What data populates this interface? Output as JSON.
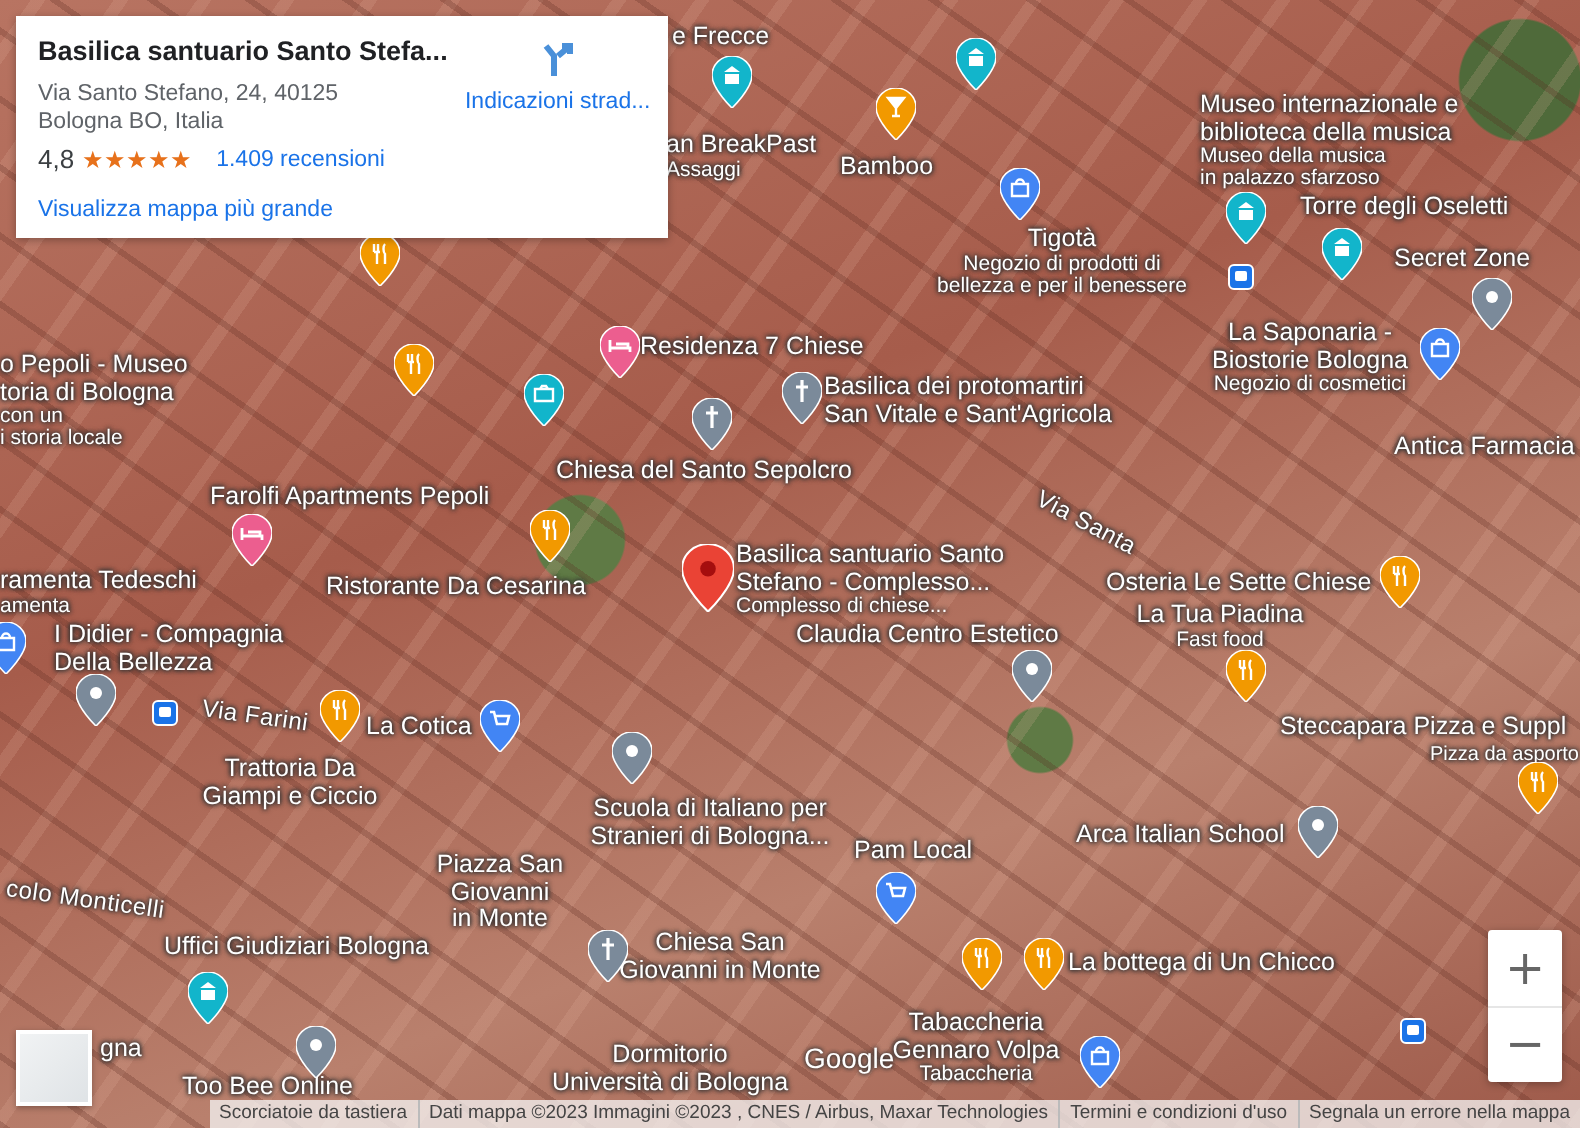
{
  "place_card": {
    "title": "Basilica santuario Santo Stefa...",
    "address_lines": [
      "Via Santo Stefano, 24, 40125",
      "Bologna BO, Italia"
    ],
    "rating": "4,8",
    "stars": 5,
    "reviews": "1.409 recensioni",
    "directions": "Indicazioni strad...",
    "larger_map": "Visualizza mappa più grande"
  },
  "map_labels": [
    {
      "kind": "place",
      "name": [
        "e Frecce"
      ]
    },
    {
      "kind": "place",
      "name": [
        "an BreakPast"
      ],
      "note": [
        "Assaggi"
      ]
    },
    {
      "kind": "place",
      "name": [
        "Bamboo"
      ]
    },
    {
      "kind": "place",
      "name": [
        "Museo internazionale e",
        "biblioteca della musica"
      ],
      "note": [
        "Museo della musica",
        "in palazzo sfarzoso"
      ]
    },
    {
      "kind": "place",
      "name": [
        "Tigotà"
      ],
      "note": [
        "Negozio di prodotti di",
        "bellezza e per il benessere"
      ]
    },
    {
      "kind": "place",
      "name": [
        "Torre degli Oseletti"
      ]
    },
    {
      "kind": "place",
      "name": [
        "Secret Zone"
      ]
    },
    {
      "kind": "place",
      "name": [
        "o Pepoli - Museo",
        "toria di Bologna"
      ],
      "note": [
        "con un",
        "i storia locale"
      ]
    },
    {
      "kind": "place",
      "name": [
        "Residenza 7 Chiese"
      ]
    },
    {
      "kind": "place",
      "name": [
        "Basilica dei protomartiri",
        "San Vitale e Sant'Agricola"
      ]
    },
    {
      "kind": "place",
      "name": [
        "La Saponaria -",
        "Biostorie Bologna"
      ],
      "note": [
        "Negozio di cosmetici"
      ]
    },
    {
      "kind": "place",
      "name": [
        "Farolfi Apartments Pepoli"
      ]
    },
    {
      "kind": "place",
      "name": [
        "Chiesa del Santo Sepolcro"
      ]
    },
    {
      "kind": "place",
      "name": [
        "Antica Farmacia"
      ]
    },
    {
      "kind": "street",
      "name": [
        "Via Santa"
      ]
    },
    {
      "kind": "place",
      "name": [
        "ramenta Tedeschi"
      ],
      "note": [
        "amenta"
      ]
    },
    {
      "kind": "place",
      "name": [
        "Ristorante Da Cesarina"
      ]
    },
    {
      "kind": "place",
      "name": [
        "Basilica santuario Santo",
        "Stefano - Complesso..."
      ],
      "note": [
        "Complesso di chiese..."
      ]
    },
    {
      "kind": "place",
      "name": [
        "Osteria Le Sette Chiese"
      ]
    },
    {
      "kind": "place",
      "name": [
        "I Didier - Compagnia",
        "Della Bellezza"
      ]
    },
    {
      "kind": "place",
      "name": [
        "Claudia Centro Estetico"
      ]
    },
    {
      "kind": "place",
      "name": [
        "La Tua Piadina"
      ],
      "note": [
        "Fast food"
      ]
    },
    {
      "kind": "street",
      "name": [
        "Via Farini"
      ]
    },
    {
      "kind": "place",
      "name": [
        "La Cotica"
      ]
    },
    {
      "kind": "place",
      "name": [
        "Steccapara Pizza e Suppl"
      ]
    },
    {
      "kind": "place",
      "name": [
        "Trattoria Da",
        "Giampi e Ciccio"
      ]
    },
    {
      "kind": "place",
      "name": [
        "Pizza da asporto"
      ],
      "small": true
    },
    {
      "kind": "place",
      "name": [
        "Scuola di Italiano per",
        "Stranieri di Bologna..."
      ]
    },
    {
      "kind": "street",
      "name": [
        "colo Monticelli"
      ]
    },
    {
      "kind": "place",
      "name": [
        "Piazza San",
        "Giovanni",
        "in Monte"
      ]
    },
    {
      "kind": "place",
      "name": [
        "Pam Local"
      ]
    },
    {
      "kind": "place",
      "name": [
        "Arca Italian School"
      ]
    },
    {
      "kind": "place",
      "name": [
        "Uffici Giudiziari Bologna"
      ]
    },
    {
      "kind": "place",
      "name": [
        "Chiesa San",
        "Giovanni in Monte"
      ]
    },
    {
      "kind": "place",
      "name": [
        "La bottega di Un Chicco"
      ]
    },
    {
      "kind": "place",
      "name": [
        "gna"
      ]
    },
    {
      "kind": "place",
      "name": [
        "Too Bee Online"
      ]
    },
    {
      "kind": "place",
      "name": [
        "Dormitorio",
        "Università di Bologna"
      ]
    },
    {
      "kind": "place",
      "name": [
        "Tabaccheria",
        "Gennaro Volpa"
      ],
      "note": [
        "Tabaccheria"
      ]
    }
  ],
  "map_pins": [
    {
      "kind": "restaurant"
    },
    {
      "kind": "restaurant"
    },
    {
      "kind": "restaurant"
    },
    {
      "kind": "restaurant"
    },
    {
      "kind": "restaurant"
    },
    {
      "kind": "restaurant"
    },
    {
      "kind": "restaurant"
    },
    {
      "kind": "restaurant"
    },
    {
      "kind": "restaurant"
    },
    {
      "kind": "bar"
    },
    {
      "kind": "museum"
    },
    {
      "kind": "museum"
    },
    {
      "kind": "museum"
    },
    {
      "kind": "tower"
    },
    {
      "kind": "tower"
    },
    {
      "kind": "shop"
    },
    {
      "kind": "shop"
    },
    {
      "kind": "shop"
    },
    {
      "kind": "shop"
    },
    {
      "kind": "cart"
    },
    {
      "kind": "cart"
    },
    {
      "kind": "hotel"
    },
    {
      "kind": "hotel"
    },
    {
      "kind": "church"
    },
    {
      "kind": "church"
    },
    {
      "kind": "church"
    },
    {
      "kind": "camera"
    },
    {
      "kind": "generic"
    },
    {
      "kind": "generic"
    },
    {
      "kind": "generic"
    },
    {
      "kind": "generic"
    },
    {
      "kind": "generic"
    },
    {
      "kind": "generic"
    },
    {
      "kind": "main"
    },
    {
      "kind": "bus"
    },
    {
      "kind": "bus"
    },
    {
      "kind": "bus"
    }
  ],
  "google_logo": "Google",
  "zoom": {
    "in": "+",
    "out": "−"
  },
  "footer": [
    "Scorciatoie da tastiera",
    "Dati mappa ©2023 Immagini ©2023 , CNES / Airbus, Maxar Technologies",
    "Termini e condizioni d'uso",
    "Segnala un errore nella mappa"
  ]
}
